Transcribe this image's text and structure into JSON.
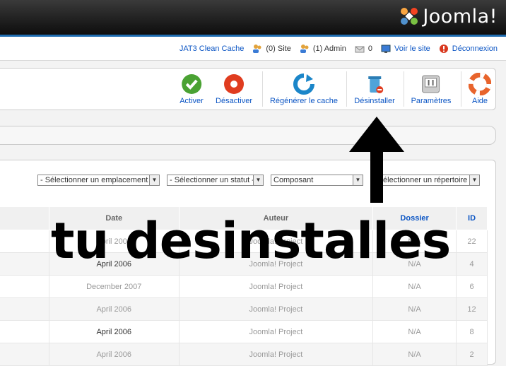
{
  "header": {
    "logo_text": "Joomla!"
  },
  "status_bar": {
    "items": [
      {
        "label": "JAT3 Clean Cache",
        "icon": null
      },
      {
        "label": "(0) Site",
        "icon": "users-icon"
      },
      {
        "label": "(1) Admin",
        "icon": "users-icon"
      },
      {
        "label": "0",
        "icon": "mail-icon"
      },
      {
        "label": "Voir le site",
        "icon": "monitor-icon"
      },
      {
        "label": "Déconnexion",
        "icon": "logout-icon"
      }
    ]
  },
  "toolbar": {
    "activate": "Activer",
    "deactivate": "Désactiver",
    "regenerate_cache": "Régénérer le cache",
    "uninstall": "Désinstaller",
    "parameters": "Paramètres",
    "help": "Aide"
  },
  "filters": {
    "location": "- Sélectionner un emplacement -",
    "status": "- Sélectionner un statut -",
    "type": "Composant",
    "directory": "- Sélectionner un répertoire -"
  },
  "table": {
    "columns": [
      "Date",
      "Auteur",
      "Dossier",
      "ID"
    ],
    "rows": [
      {
        "date": "April 2006",
        "author": "Joomla! Project",
        "folder": "N/A",
        "id": "22"
      },
      {
        "date": "April 2006",
        "author": "Joomla! Project",
        "folder": "N/A",
        "id": "4"
      },
      {
        "date": "December 2007",
        "author": "Joomla! Project",
        "folder": "N/A",
        "id": "6"
      },
      {
        "date": "April 2006",
        "author": "Joomla! Project",
        "folder": "N/A",
        "id": "12"
      },
      {
        "date": "April 2006",
        "author": "Joomla! Project",
        "folder": "N/A",
        "id": "8"
      },
      {
        "date": "April 2006",
        "author": "Joomla! Project",
        "folder": "N/A",
        "id": "2"
      }
    ]
  },
  "annotation": {
    "text": "tu desinstalles"
  },
  "colors": {
    "link": "#0b55c4",
    "header_bg": "#111111",
    "header_accent": "#1e6cb0"
  }
}
